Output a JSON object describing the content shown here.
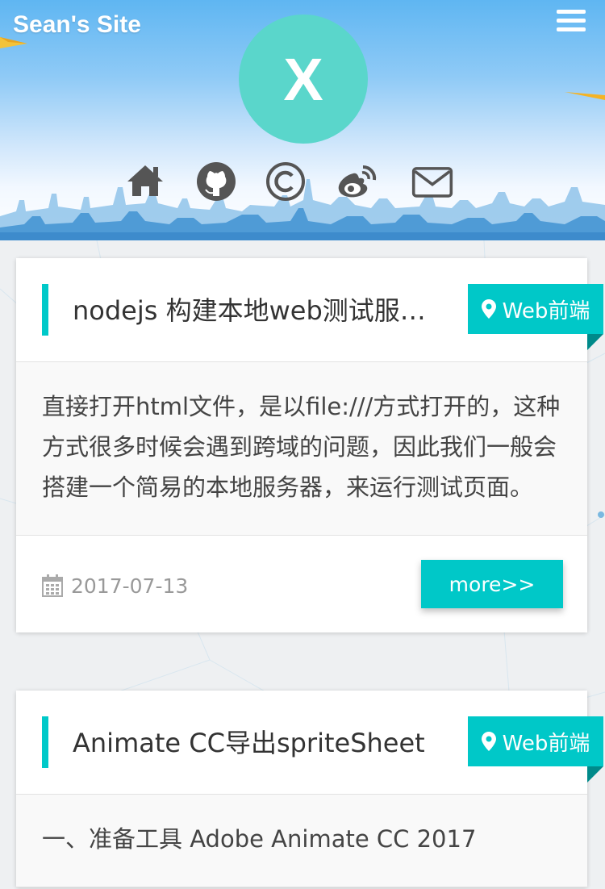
{
  "header": {
    "site_title": "Sean's Site",
    "avatar_letter": "X"
  },
  "social": {
    "icons": [
      "home-icon",
      "github-icon",
      "copyright-icon",
      "weibo-icon",
      "mail-icon"
    ]
  },
  "theme": {
    "accent": "#00c8c8",
    "avatar_bg": "#5ad6cb"
  },
  "posts": [
    {
      "title": "nodejs 构建本地web测试服务器",
      "category": "Web前端",
      "excerpt": "直接打开html文件，是以file:///方式打开的，这种方式很多时候会遇到跨域的问题，因此我们一般会搭建一个简易的本地服务器，来运行测试页面。",
      "date": "2017-07-13",
      "more_label": "more>>"
    },
    {
      "title": "Animate CC导出spriteSheet",
      "category": "Web前端",
      "excerpt": "一、准备工具 Adobe Animate CC 2017"
    }
  ]
}
